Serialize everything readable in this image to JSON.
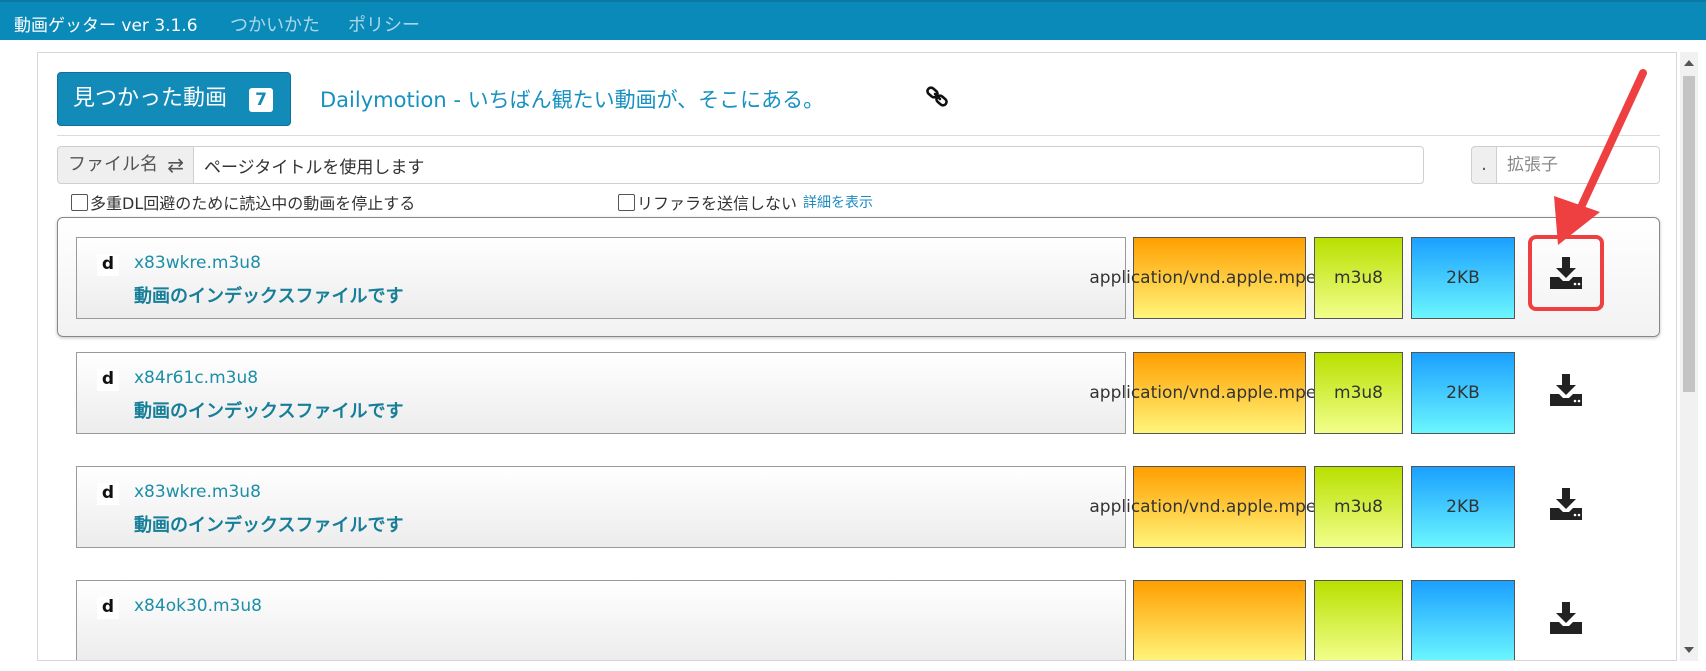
{
  "app": {
    "title": "動画ゲッター ver 3.1.6",
    "nav": [
      "つかいかた",
      "ポリシー"
    ]
  },
  "header": {
    "found_label": "見つかった動画",
    "found_count": "7",
    "page_title": "Dailymotion - いちばん観たい動画が、そこにある。",
    "link_icon": "link-icon"
  },
  "filename": {
    "label": "ファイル名",
    "swap_icon": "⇄",
    "value": "ページタイトルを使用します",
    "ext_dot": ".",
    "ext_placeholder": "拡張子"
  },
  "options": {
    "stop_dup": "多重DL回避のために読込中の動画を停止する",
    "no_referer": "リファラを送信しない",
    "details": "詳細を表示"
  },
  "colors": {
    "topbar": "#0a8ab8",
    "accent": "#128bb8",
    "highlight": "#ee4040"
  },
  "rows": [
    {
      "site_icon": "d",
      "name": "x83wkre.m3u8",
      "desc": "動画のインデックスファイルです",
      "mime": "application/vnd.apple.mpegurl",
      "ext": "m3u8",
      "size": "2KB",
      "selected": true
    },
    {
      "site_icon": "d",
      "name": "x84r61c.m3u8",
      "desc": "動画のインデックスファイルです",
      "mime": "application/vnd.apple.mpegurl",
      "ext": "m3u8",
      "size": "2KB",
      "selected": false
    },
    {
      "site_icon": "d",
      "name": "x83wkre.m3u8",
      "desc": "動画のインデックスファイルです",
      "mime": "application/vnd.apple.mpegurl",
      "ext": "m3u8",
      "size": "2KB",
      "selected": false
    },
    {
      "site_icon": "d",
      "name": "x84ok30.m3u8",
      "desc": "",
      "mime": "",
      "ext": "",
      "size": "",
      "selected": false
    }
  ]
}
